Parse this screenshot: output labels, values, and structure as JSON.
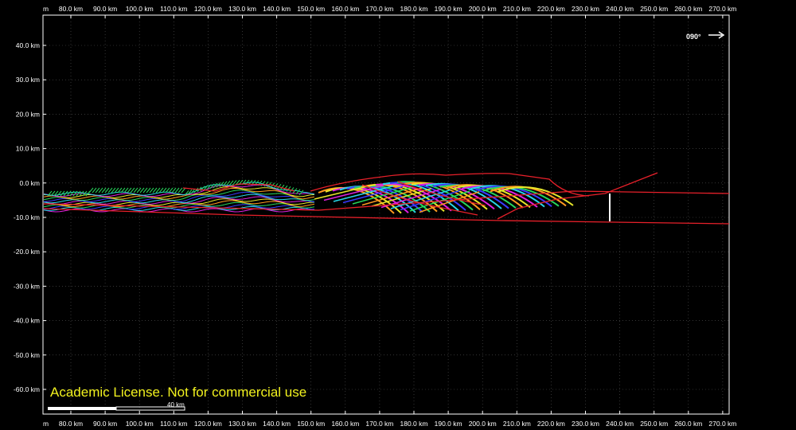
{
  "view": {
    "x_axis": {
      "top_labels": [
        "m",
        "80.0 km",
        "90.0 km",
        "100.0 km",
        "110.0 km",
        "120.0 km",
        "130.0 km",
        "140.0 km",
        "150.0 km",
        "160.0 km",
        "170.0 km",
        "180.0 km",
        "190.0 km",
        "200.0 km",
        "210.0 km",
        "220.0 km",
        "230.0 km",
        "240.0 km",
        "250.0 km",
        "260.0 km",
        "270.0 km"
      ],
      "bottom_labels": [
        "m",
        "80.0 km",
        "90.0 km",
        "100.0 km",
        "110.0 km",
        "120.0 km",
        "130.0 km",
        "140.0 km",
        "150.0 km",
        "160.0 km",
        "170.0 km",
        "180.0 km",
        "190.0 km",
        "200.0 km",
        "210.0 km",
        "220.0 km",
        "230.0 km",
        "240.0 km",
        "250.0 km",
        "260.0 km",
        "270.0 km"
      ]
    },
    "y_axis": {
      "labels": [
        "40.0 km",
        "30.0 km",
        "20.0 km",
        "10.0 km",
        "0.0 km",
        "-10.0 km",
        "-20.0 km",
        "-30.0 km",
        "-40.0 km",
        "-50.0 km",
        "-60.0 km"
      ]
    },
    "heading": "090°",
    "scale_bar_label": "40 km",
    "watermark": "Academic License. Not for commercial use",
    "colors": {
      "background": "#000000",
      "fault": "#e8202a",
      "layer_orange": "#ff9a1f",
      "layer_yellow": "#e6e62a",
      "layer_magenta": "#e01fe0",
      "layer_cyan": "#26d6e8",
      "layer_blue": "#3a3aff",
      "layer_green": "#27d65b",
      "watermark": "#f2f21e"
    }
  }
}
